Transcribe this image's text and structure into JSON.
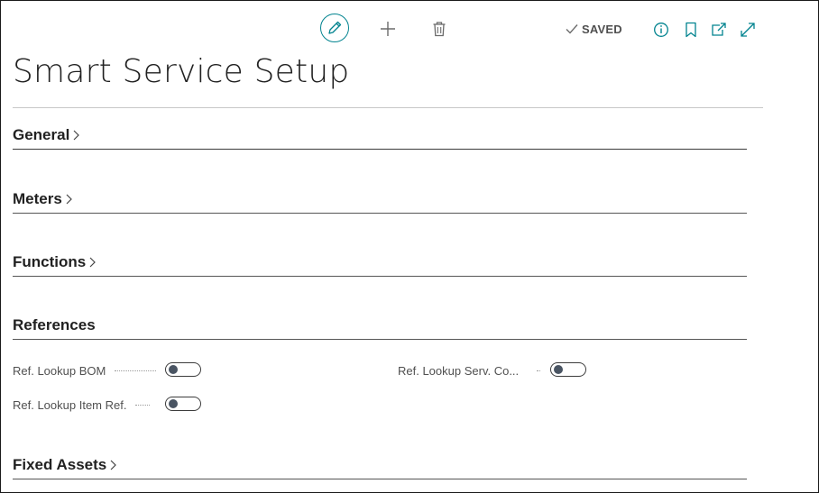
{
  "page": {
    "title": "Smart Service Setup",
    "status": "SAVED"
  },
  "toolbar": {
    "icons": [
      "pencil-icon",
      "plus-icon",
      "trash-icon",
      "checkmark-icon",
      "info-icon",
      "bookmark-icon",
      "popout-icon",
      "expand-icon"
    ]
  },
  "colors": {
    "accent": "#00838f",
    "text": "#212121",
    "muted": "#505050"
  },
  "sections": {
    "general": "General",
    "meters": "Meters",
    "functions": "Functions",
    "references": "References",
    "fixed_assets": "Fixed Assets"
  },
  "references": {
    "fields": [
      {
        "label": "Ref. Lookup BOM",
        "value": false
      },
      {
        "label": "Ref. Lookup Item Ref.",
        "value": false
      },
      {
        "label": "Ref. Lookup Serv. Co...",
        "value": false
      }
    ]
  }
}
